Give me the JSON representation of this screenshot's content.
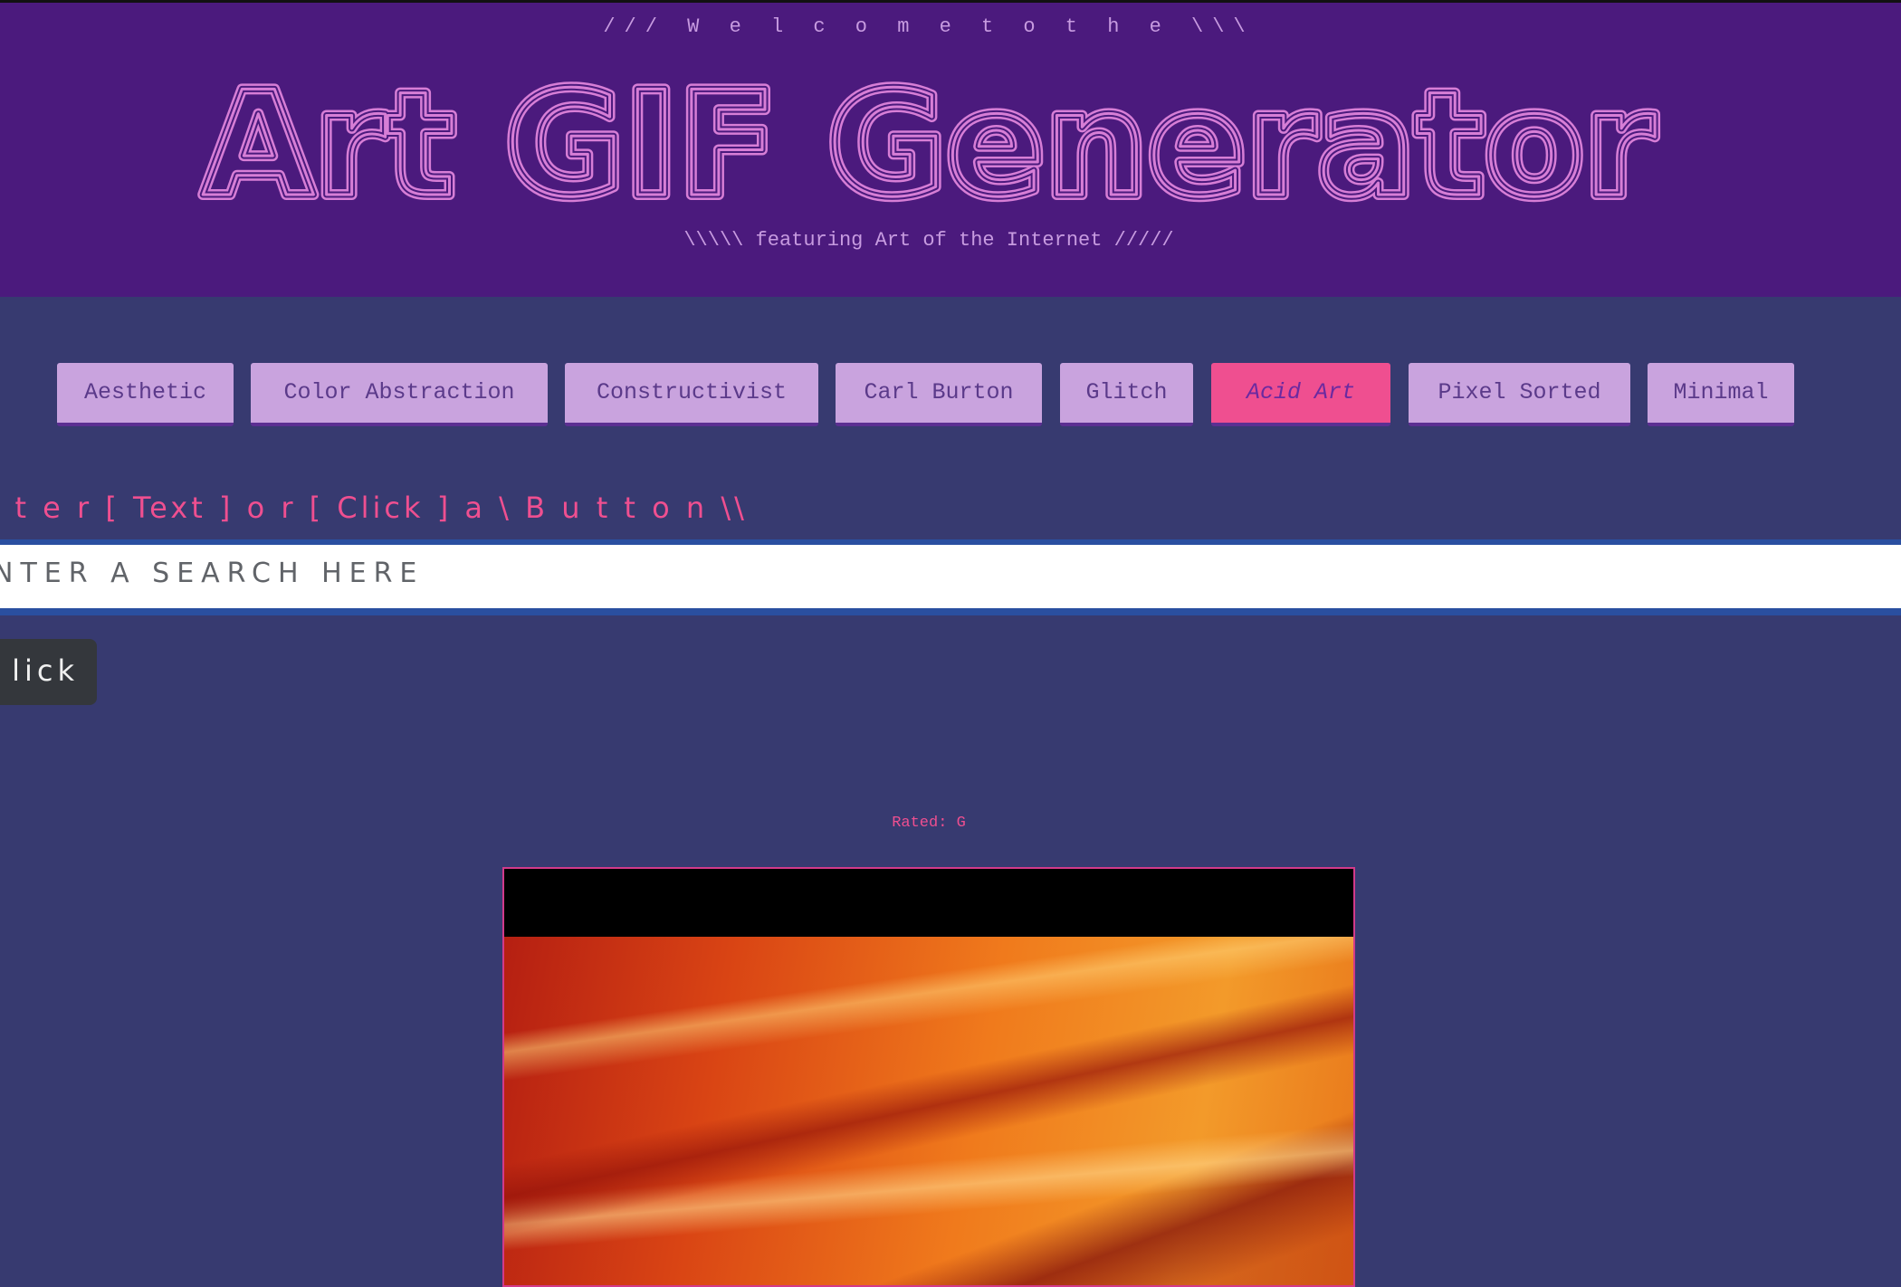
{
  "header": {
    "welcome": "/// W e l c o m e t o t h e \\\\\\",
    "title": "Art GIF Generator",
    "subtitle": "\\\\\\\\\\ featuring Art of the Internet /////"
  },
  "categories": [
    {
      "label": "Aesthetic",
      "active": false
    },
    {
      "label": "Color Abstraction",
      "active": false
    },
    {
      "label": "Constructivist",
      "active": false
    },
    {
      "label": "Carl Burton",
      "active": false
    },
    {
      "label": "Glitch",
      "active": false
    },
    {
      "label": "Acid Art",
      "active": true
    },
    {
      "label": "Pixel Sorted",
      "active": false
    },
    {
      "label": "Minimal",
      "active": false
    }
  ],
  "instruction": "n t e r [ Text ] o r [ Click ] a \\ B u t t o n \\\\",
  "search": {
    "placeholder": "NTER A SEARCH HERE",
    "value": ""
  },
  "click_button": {
    "label": "lick"
  },
  "result": {
    "rating": "Rated: G"
  },
  "colors": {
    "page_bg": "#373a70",
    "header_bg": "#4b1a7d",
    "button_bg": "#c9a3de",
    "active_button_bg": "#ef4f90",
    "accent_pink": "#ef4f90",
    "title_stroke": "#d77ed6"
  }
}
